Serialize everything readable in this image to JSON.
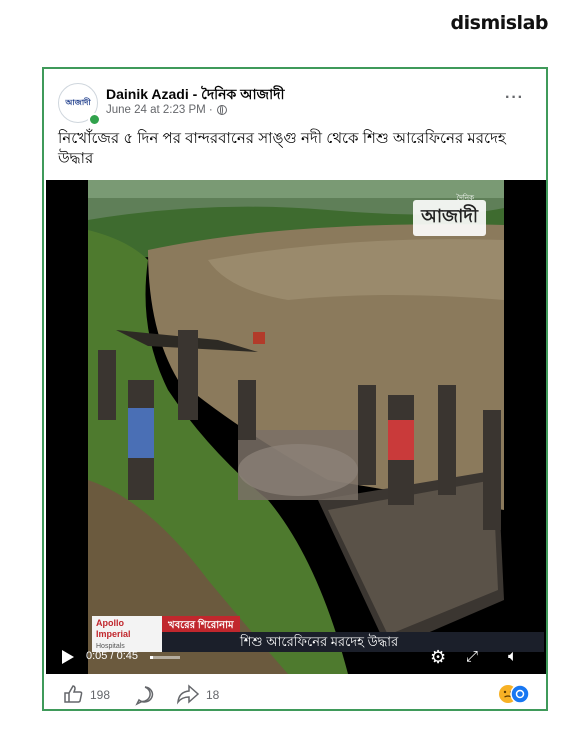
{
  "brand": "dismislab",
  "post": {
    "page_name": "Dainik Azadi - দৈনিক আজাদী",
    "avatar_text": "আজাদী",
    "date": "June 24 at 2:23 PM ·",
    "more_label": "···",
    "caption": "নিখোঁজের ৫ দিন পর বান্দরবানের সাঙ্গু নদী থেকে শিশু আরেফিনের মরদেহ উদ্ধার",
    "privacy_icon": "globe-icon"
  },
  "video": {
    "logo": "আজাদী",
    "logo_sub": "দৈনিক",
    "sponsor": "Apollo Imperial",
    "sponsor_sub": "Hospitals",
    "ticker_label": "খবরের শিরোনাম",
    "ticker_text": "শিশু আরেফিনের মরদেহ উদ্ধার",
    "time": "0:05 / 0:45",
    "progress": 0.11
  },
  "footer": {
    "likes": "198",
    "shares": "18"
  },
  "colors": {
    "card_border": "#3f9a5a",
    "ticker_red": "#c1272d",
    "online": "#31a24c"
  }
}
